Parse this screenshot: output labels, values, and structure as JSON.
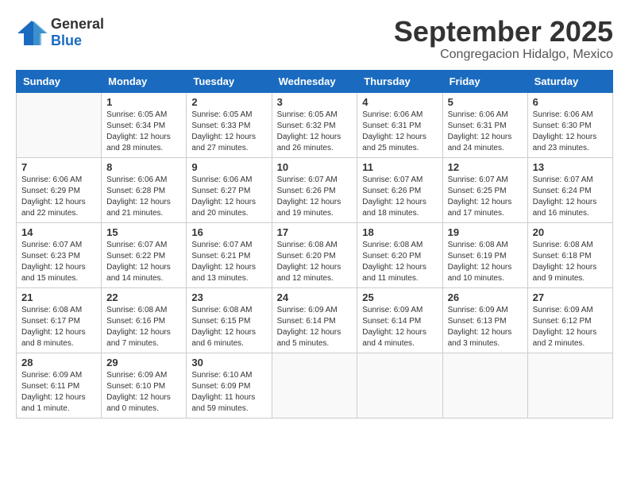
{
  "header": {
    "logo_general": "General",
    "logo_blue": "Blue",
    "month": "September 2025",
    "location": "Congregacion Hidalgo, Mexico"
  },
  "days_of_week": [
    "Sunday",
    "Monday",
    "Tuesday",
    "Wednesday",
    "Thursday",
    "Friday",
    "Saturday"
  ],
  "weeks": [
    [
      {
        "day": "",
        "info": ""
      },
      {
        "day": "1",
        "info": "Sunrise: 6:05 AM\nSunset: 6:34 PM\nDaylight: 12 hours\nand 28 minutes."
      },
      {
        "day": "2",
        "info": "Sunrise: 6:05 AM\nSunset: 6:33 PM\nDaylight: 12 hours\nand 27 minutes."
      },
      {
        "day": "3",
        "info": "Sunrise: 6:05 AM\nSunset: 6:32 PM\nDaylight: 12 hours\nand 26 minutes."
      },
      {
        "day": "4",
        "info": "Sunrise: 6:06 AM\nSunset: 6:31 PM\nDaylight: 12 hours\nand 25 minutes."
      },
      {
        "day": "5",
        "info": "Sunrise: 6:06 AM\nSunset: 6:31 PM\nDaylight: 12 hours\nand 24 minutes."
      },
      {
        "day": "6",
        "info": "Sunrise: 6:06 AM\nSunset: 6:30 PM\nDaylight: 12 hours\nand 23 minutes."
      }
    ],
    [
      {
        "day": "7",
        "info": "Sunrise: 6:06 AM\nSunset: 6:29 PM\nDaylight: 12 hours\nand 22 minutes."
      },
      {
        "day": "8",
        "info": "Sunrise: 6:06 AM\nSunset: 6:28 PM\nDaylight: 12 hours\nand 21 minutes."
      },
      {
        "day": "9",
        "info": "Sunrise: 6:06 AM\nSunset: 6:27 PM\nDaylight: 12 hours\nand 20 minutes."
      },
      {
        "day": "10",
        "info": "Sunrise: 6:07 AM\nSunset: 6:26 PM\nDaylight: 12 hours\nand 19 minutes."
      },
      {
        "day": "11",
        "info": "Sunrise: 6:07 AM\nSunset: 6:26 PM\nDaylight: 12 hours\nand 18 minutes."
      },
      {
        "day": "12",
        "info": "Sunrise: 6:07 AM\nSunset: 6:25 PM\nDaylight: 12 hours\nand 17 minutes."
      },
      {
        "day": "13",
        "info": "Sunrise: 6:07 AM\nSunset: 6:24 PM\nDaylight: 12 hours\nand 16 minutes."
      }
    ],
    [
      {
        "day": "14",
        "info": "Sunrise: 6:07 AM\nSunset: 6:23 PM\nDaylight: 12 hours\nand 15 minutes."
      },
      {
        "day": "15",
        "info": "Sunrise: 6:07 AM\nSunset: 6:22 PM\nDaylight: 12 hours\nand 14 minutes."
      },
      {
        "day": "16",
        "info": "Sunrise: 6:07 AM\nSunset: 6:21 PM\nDaylight: 12 hours\nand 13 minutes."
      },
      {
        "day": "17",
        "info": "Sunrise: 6:08 AM\nSunset: 6:20 PM\nDaylight: 12 hours\nand 12 minutes."
      },
      {
        "day": "18",
        "info": "Sunrise: 6:08 AM\nSunset: 6:20 PM\nDaylight: 12 hours\nand 11 minutes."
      },
      {
        "day": "19",
        "info": "Sunrise: 6:08 AM\nSunset: 6:19 PM\nDaylight: 12 hours\nand 10 minutes."
      },
      {
        "day": "20",
        "info": "Sunrise: 6:08 AM\nSunset: 6:18 PM\nDaylight: 12 hours\nand 9 minutes."
      }
    ],
    [
      {
        "day": "21",
        "info": "Sunrise: 6:08 AM\nSunset: 6:17 PM\nDaylight: 12 hours\nand 8 minutes."
      },
      {
        "day": "22",
        "info": "Sunrise: 6:08 AM\nSunset: 6:16 PM\nDaylight: 12 hours\nand 7 minutes."
      },
      {
        "day": "23",
        "info": "Sunrise: 6:08 AM\nSunset: 6:15 PM\nDaylight: 12 hours\nand 6 minutes."
      },
      {
        "day": "24",
        "info": "Sunrise: 6:09 AM\nSunset: 6:14 PM\nDaylight: 12 hours\nand 5 minutes."
      },
      {
        "day": "25",
        "info": "Sunrise: 6:09 AM\nSunset: 6:14 PM\nDaylight: 12 hours\nand 4 minutes."
      },
      {
        "day": "26",
        "info": "Sunrise: 6:09 AM\nSunset: 6:13 PM\nDaylight: 12 hours\nand 3 minutes."
      },
      {
        "day": "27",
        "info": "Sunrise: 6:09 AM\nSunset: 6:12 PM\nDaylight: 12 hours\nand 2 minutes."
      }
    ],
    [
      {
        "day": "28",
        "info": "Sunrise: 6:09 AM\nSunset: 6:11 PM\nDaylight: 12 hours\nand 1 minute."
      },
      {
        "day": "29",
        "info": "Sunrise: 6:09 AM\nSunset: 6:10 PM\nDaylight: 12 hours\nand 0 minutes."
      },
      {
        "day": "30",
        "info": "Sunrise: 6:10 AM\nSunset: 6:09 PM\nDaylight: 11 hours\nand 59 minutes."
      },
      {
        "day": "",
        "info": ""
      },
      {
        "day": "",
        "info": ""
      },
      {
        "day": "",
        "info": ""
      },
      {
        "day": "",
        "info": ""
      }
    ]
  ]
}
